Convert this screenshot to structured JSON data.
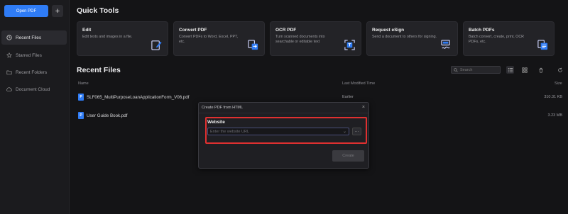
{
  "sidebar": {
    "open_pdf": "Open PDF",
    "plus": "+",
    "items": [
      {
        "label": "Recent Files",
        "icon": "clock-icon",
        "active": true
      },
      {
        "label": "Starred Files",
        "icon": "star-icon",
        "active": false
      },
      {
        "label": "Recent Folders",
        "icon": "folder-icon",
        "active": false
      },
      {
        "label": "Document Cloud",
        "icon": "cloud-icon",
        "active": false
      }
    ]
  },
  "quick_tools": {
    "heading": "Quick Tools",
    "cards": [
      {
        "title": "Edit",
        "desc": "Edit texts and images in a file.",
        "icon": "edit-icon"
      },
      {
        "title": "Convert PDF",
        "desc": "Convert PDFs to Word, Excel, PPT, etc.",
        "icon": "convert-icon"
      },
      {
        "title": "OCR PDF",
        "desc": "Turn scanned documents into searchable or editable text",
        "icon": "ocr-icon"
      },
      {
        "title": "Request eSign",
        "desc": "Send a document to others for signing.",
        "icon": "esign-icon"
      },
      {
        "title": "Batch PDFs",
        "desc": "Batch convert, create, print, OCR PDFs, etc.",
        "icon": "batch-icon"
      }
    ]
  },
  "recent": {
    "heading": "Recent Files",
    "search_placeholder": "Search",
    "columns": {
      "name": "Name",
      "modified": "Last Modified Time",
      "size": "Size"
    },
    "files": [
      {
        "name": "SLF065_MultiPurposeLoanApplicationForm_V06.pdf",
        "modified": "Earlier",
        "size": "310.31 KB"
      },
      {
        "name": "User Guide Book.pdf",
        "modified": "",
        "size": "3.23 MB"
      }
    ]
  },
  "dialog": {
    "title": "Create PDF from HTML",
    "close": "×",
    "label": "Website",
    "url_placeholder": "Enter the website URL",
    "more": "···",
    "create": "Create"
  },
  "colors": {
    "accent": "#2f7cf6",
    "highlight": "#e03030",
    "background": "#141416"
  }
}
